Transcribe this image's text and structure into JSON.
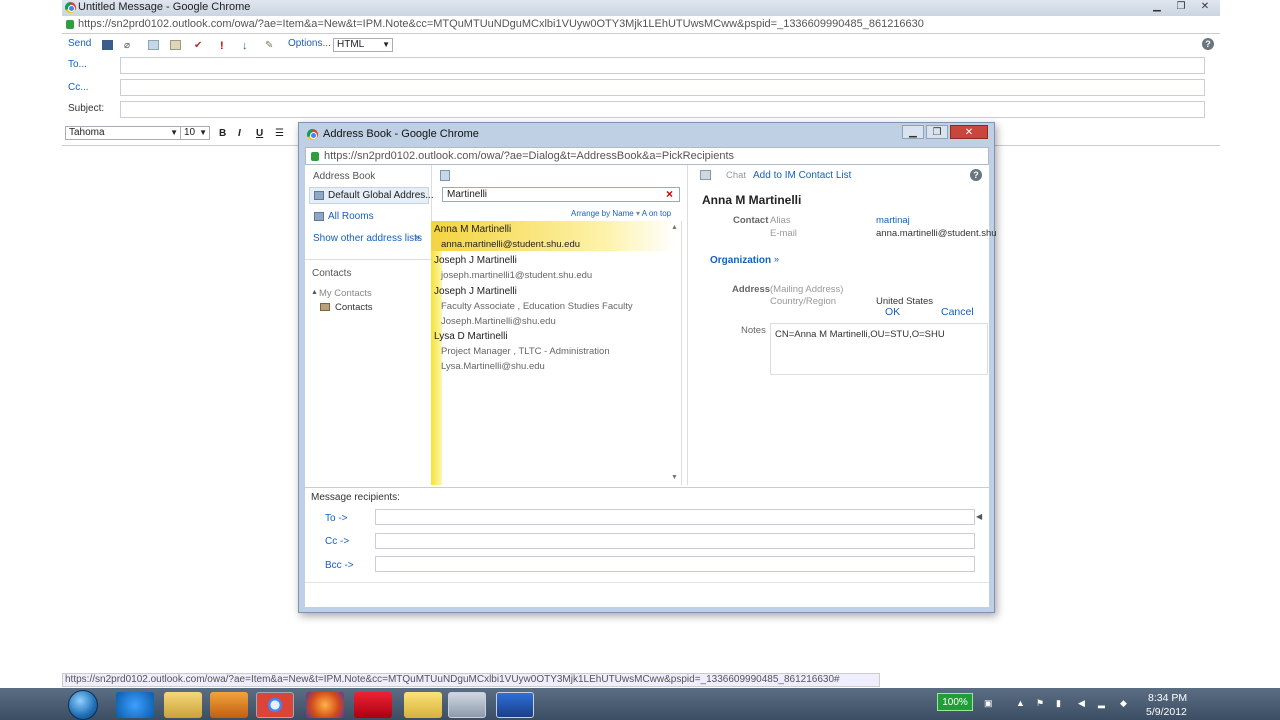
{
  "main_window": {
    "title": "Untitled Message - Google Chrome",
    "url": "https://sn2prd0102.outlook.com/owa/?ae=Item&a=New&t=IPM.Note&cc=MTQuMTUuNDguMCxlbi1VUyw0OTY3Mjk1LEhUTUwsMCww&pspid=_1336609990485_861216630",
    "status_url": "https://sn2prd0102.outlook.com/owa/?ae=Item&a=New&t=IPM.Note&cc=MTQuMTUuNDguMCxlbi1VUyw0OTY3Mjk1LEhUTUwsMCww&pspid=_1336609990485_861216630#"
  },
  "compose": {
    "toolbar": {
      "send": "Send",
      "options": "Options...",
      "format": "HTML"
    },
    "to_label": "To...",
    "cc_label": "Cc...",
    "subject_label": "Subject:",
    "font": "Tahoma",
    "font_size": "10",
    "bold": "B",
    "italic": "I",
    "underline": "U"
  },
  "dialog": {
    "title": "Address Book - Google Chrome",
    "url": "https://sn2prd0102.outlook.com/owa/?ae=Dialog&t=AddressBook&a=PickRecipients",
    "nav": {
      "heading": "Address Book",
      "global_list": "Default Global Addres...",
      "all_rooms": "All Rooms",
      "show_other": "Show other address lists",
      "contacts_heading": "Contacts",
      "my_contacts": "My Contacts",
      "contacts": "Contacts"
    },
    "search": {
      "value": "Martinelli",
      "arrange": "Arrange by Name",
      "order": "A on top"
    },
    "results": [
      {
        "name": "Anna M Martinelli",
        "details": [
          "anna.martinelli@student.shu.edu"
        ]
      },
      {
        "name": "Joseph J Martinelli",
        "details": [
          "joseph.martinelli1@student.shu.edu"
        ]
      },
      {
        "name": "Joseph J Martinelli",
        "details": [
          "Faculty Associate , Education Studies Faculty",
          "Joseph.Martinelli@shu.edu"
        ]
      },
      {
        "name": "Lysa D Martinelli",
        "details": [
          "Project Manager , TLTC - Administration",
          "Lysa.Martinelli@shu.edu"
        ]
      }
    ],
    "detail": {
      "chat": "Chat",
      "add_im": "Add to IM Contact List",
      "name": "Anna M Martinelli",
      "contact_label": "Contact",
      "alias_label": "Alias",
      "alias_value": "martinaj",
      "email_label": "E-mail",
      "email_value": "anna.martinelli@student.shu",
      "organization": "Organization",
      "address_label": "Address",
      "mailing_label": "(Mailing Address)",
      "country_label": "Country/Region",
      "country_value": "United States",
      "notes_label": "Notes",
      "notes_value": "CN=Anna M Martinelli,OU=STU,O=SHU"
    },
    "recipients": {
      "label": "Message recipients:",
      "to": "To ->",
      "cc": "Cc ->",
      "bcc": "Bcc ->"
    },
    "ok": "OK",
    "cancel": "Cancel"
  },
  "taskbar": {
    "battery": "100%",
    "time": "8:34 PM",
    "date": "5/9/2012"
  }
}
